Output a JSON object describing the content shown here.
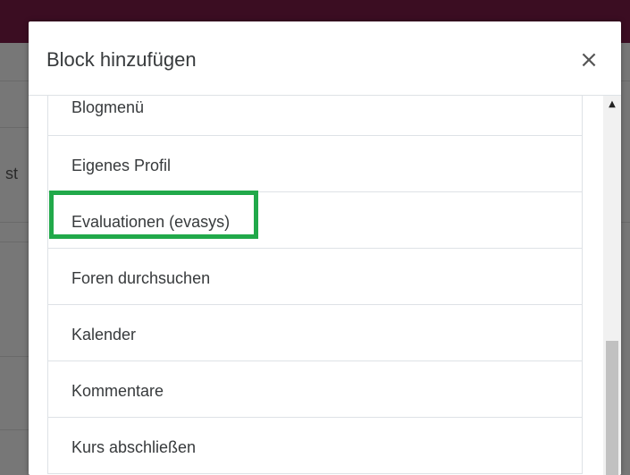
{
  "modal": {
    "title": "Block hinzufügen",
    "close_label": "×"
  },
  "background": {
    "partial_text": "st"
  },
  "blocks": [
    {
      "label": "Blogmenü"
    },
    {
      "label": "Eigenes Profil"
    },
    {
      "label": "Evaluationen (evasys)",
      "highlighted": true
    },
    {
      "label": "Foren durchsuchen"
    },
    {
      "label": "Kalender"
    },
    {
      "label": "Kommentare"
    },
    {
      "label": "Kurs abschließen"
    }
  ],
  "scrollbar": {
    "up_arrow": "▲"
  },
  "colors": {
    "highlight": "#21a94a",
    "topbar": "#3b0d22",
    "text": "#373a3c"
  }
}
